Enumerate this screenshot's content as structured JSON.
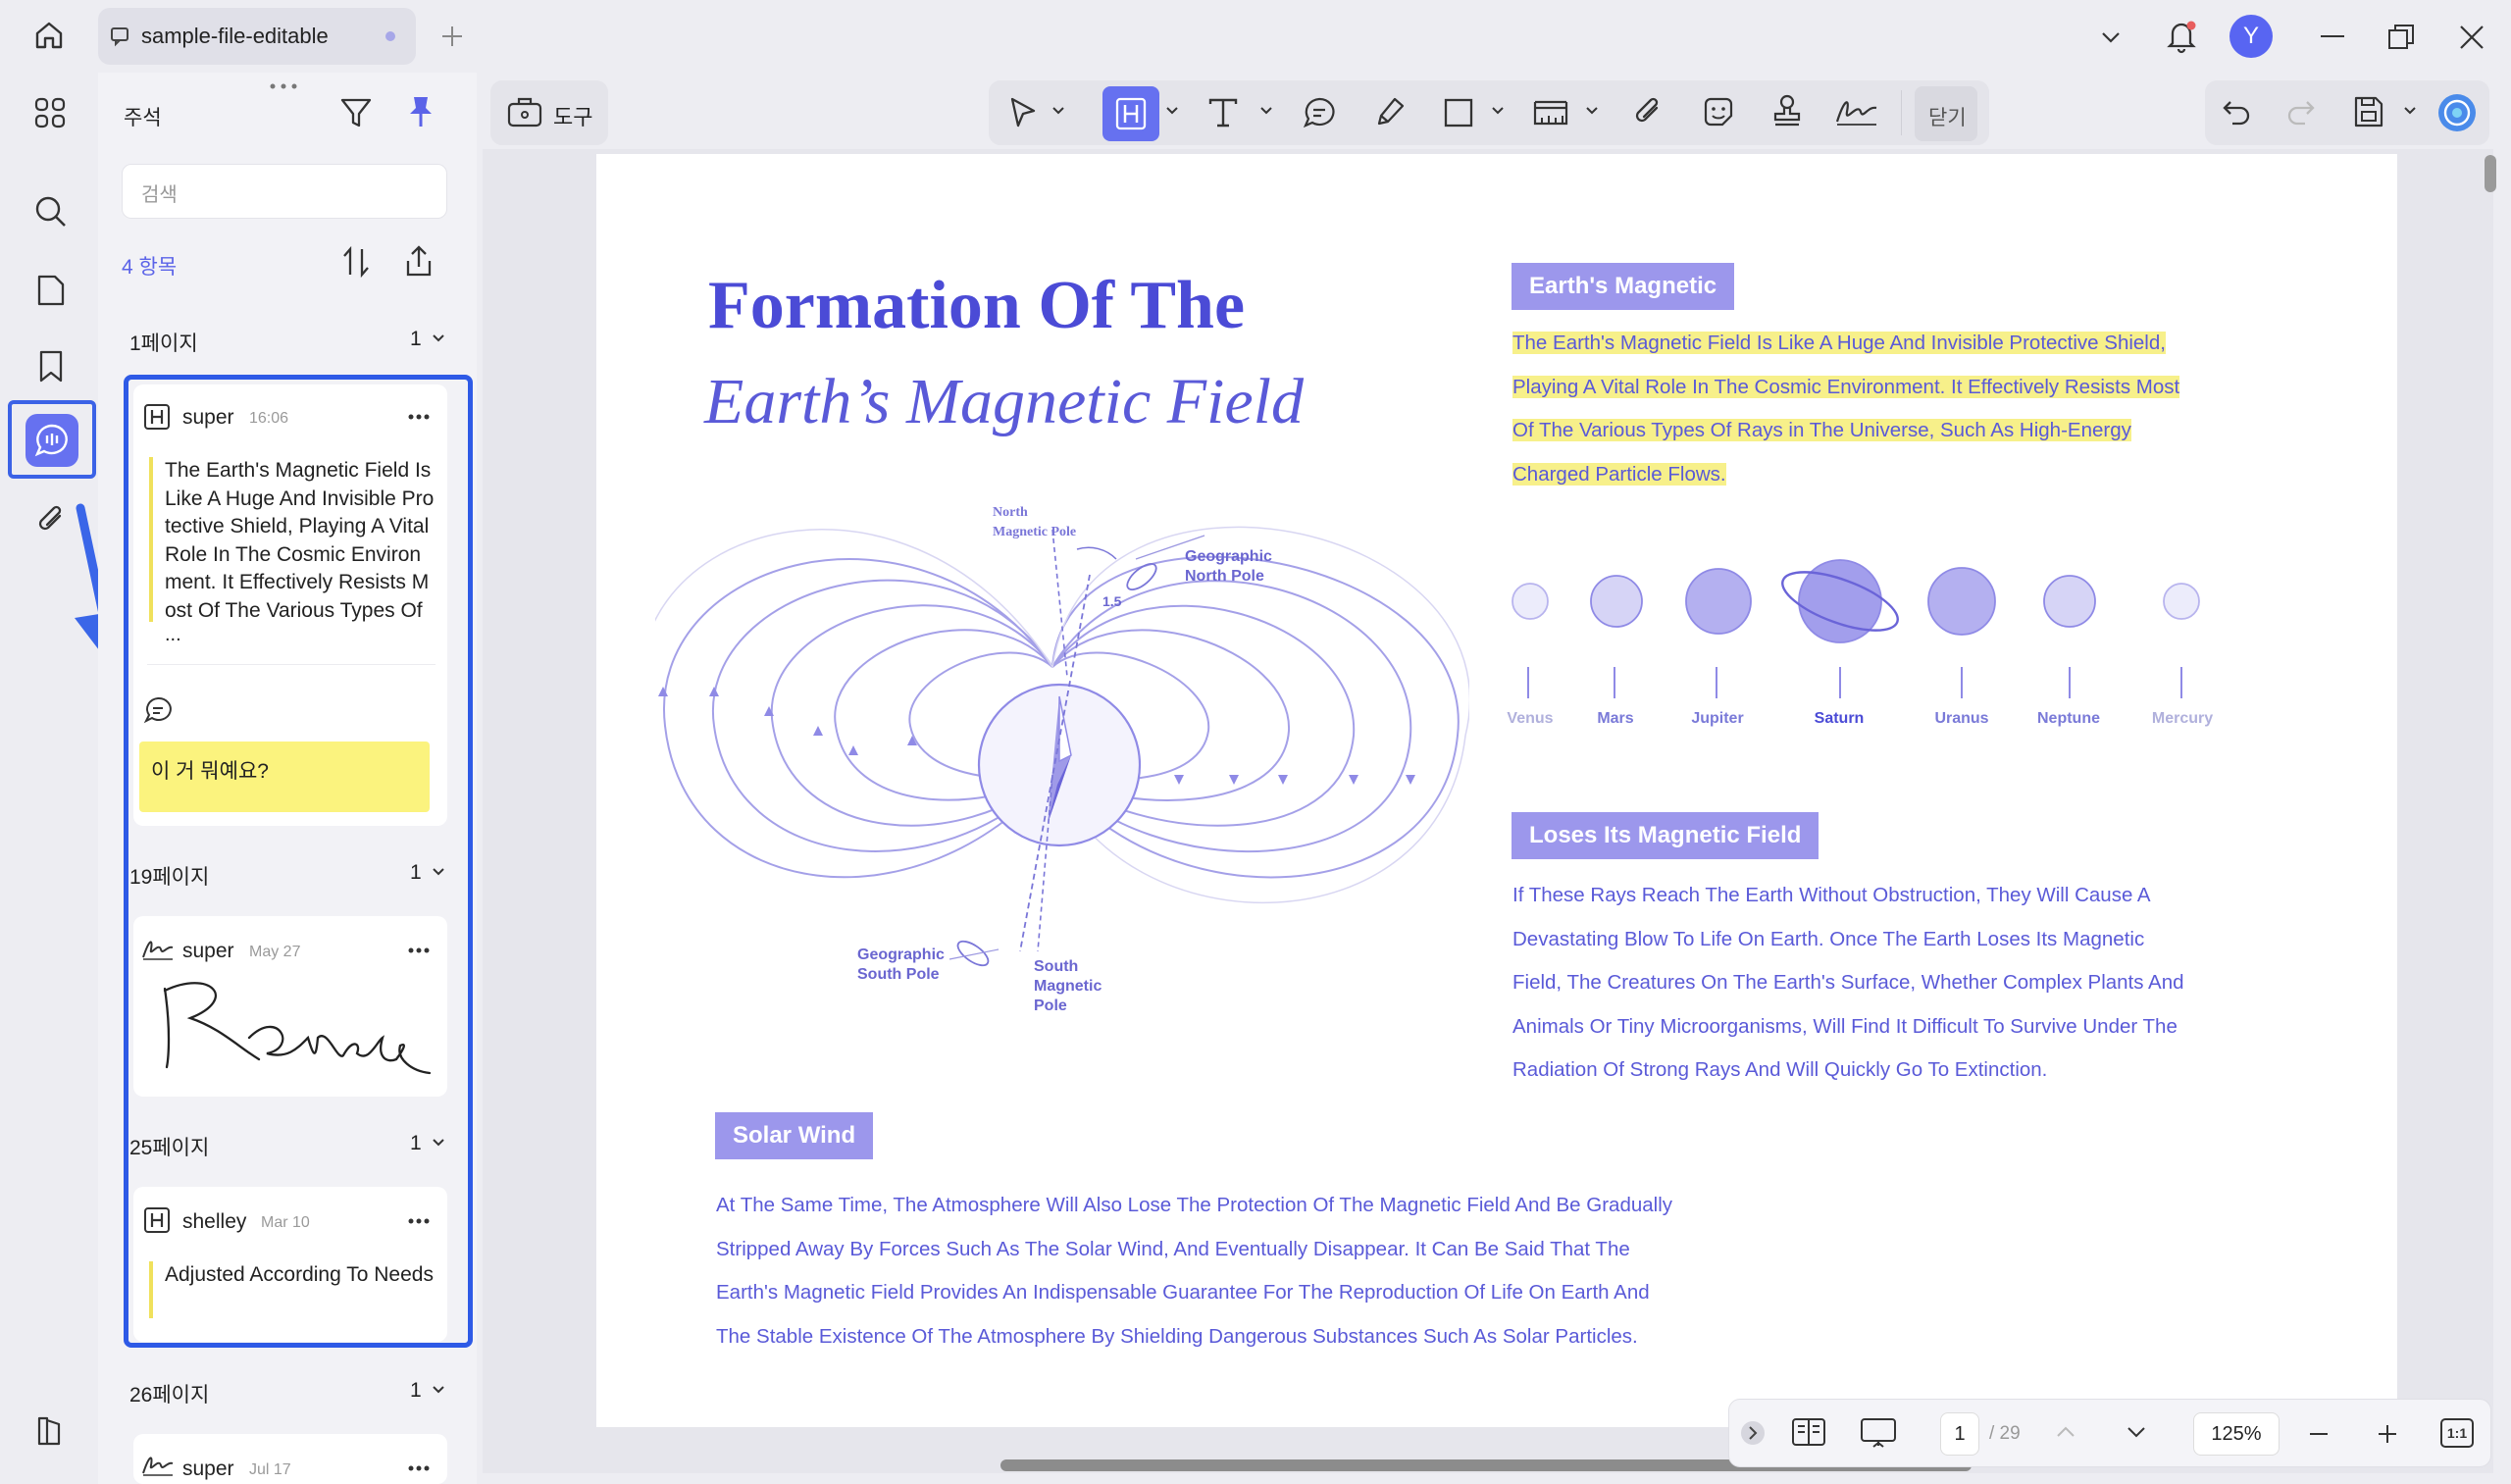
{
  "tab": {
    "title": "sample-file-editable"
  },
  "user": {
    "avatar_letter": "Y"
  },
  "panel": {
    "title": "주석",
    "search_placeholder": "검색",
    "count": "4 항목",
    "groups": [
      {
        "page": "1페이지",
        "count": "1"
      },
      {
        "page": "19페이지",
        "count": "1"
      },
      {
        "page": "25페이지",
        "count": "1"
      },
      {
        "page": "26페이지",
        "count": "1"
      }
    ],
    "cards": [
      {
        "user": "super",
        "time": "16:06",
        "quote": "The Earth's Magnetic Field Is Like A Huge And Invisible Protective Shield, Playing A Vital Role In The Cosmic Environment. It Effectively Resists Most Of The Various Types Of R",
        "ellipsis": "...",
        "comment": "이 거 뭐예요?"
      },
      {
        "user": "super",
        "time": "May 27",
        "signature": "Renee"
      },
      {
        "user": "shelley",
        "time": "Mar 10",
        "quote": "Adjusted According To Needs"
      },
      {
        "user": "super",
        "time": "Jul 17"
      }
    ]
  },
  "toolbar": {
    "tools_label": "도구",
    "close_label": "닫기"
  },
  "document": {
    "title_line1": "Formation Of The",
    "title_line2": "Earth’s Magnetic Field",
    "sec1_label": "Earth's Magnetic",
    "sec1_lines": [
      "The Earth's Magnetic Field Is Like A Huge And Invisible Protective Shield,",
      "Playing A Vital Role In The Cosmic Environment. It Effectively Resists Most",
      "Of The Various Types Of Rays in The Universe, Such As High-Energy",
      "Charged Particle Flows."
    ],
    "planets": [
      "Venus",
      "Mars",
      "Jupiter",
      "Saturn",
      "Uranus",
      "Neptune",
      "Mercury"
    ],
    "sec2_label": "Loses Its Magnetic Field",
    "sec2_lines": [
      "If These Rays Reach The Earth Without Obstruction, They Will Cause A",
      "Devastating Blow To Life On Earth. Once The Earth Loses Its Magnetic",
      "Field, The Creatures On The Earth's Surface, Whether Complex Plants And",
      "Animals Or Tiny Microorganisms, Will Find It Difficult To Survive Under The",
      "Radiation Of Strong Rays And Will Quickly Go To Extinction."
    ],
    "sec3_label": "Solar Wind",
    "sec3_lines": [
      "At The Same Time, The Atmosphere Will Also Lose The Protection Of The Magnetic Field And Be Gradually",
      "Stripped Away By Forces Such As The Solar Wind, And Eventually Disappear. It Can Be Said That The",
      "Earth's Magnetic Field Provides An Indispensable Guarantee For The Reproduction Of Life On Earth And",
      "The Stable Existence Of The Atmosphere By Shielding Dangerous Substances Such As Solar Particles."
    ],
    "diagram": {
      "north_mag": [
        "North",
        "Magnetic Pole"
      ],
      "geo_north": [
        "Geographic",
        "North Pole"
      ],
      "angle": "1.5",
      "geo_south": [
        "Geographic",
        "South Pole"
      ],
      "south_mag": [
        "South",
        "Magnetic",
        "Pole"
      ]
    }
  },
  "status": {
    "page_current": "1",
    "page_total": "/ 29",
    "zoom": "125%",
    "fit_label": "1:1"
  }
}
